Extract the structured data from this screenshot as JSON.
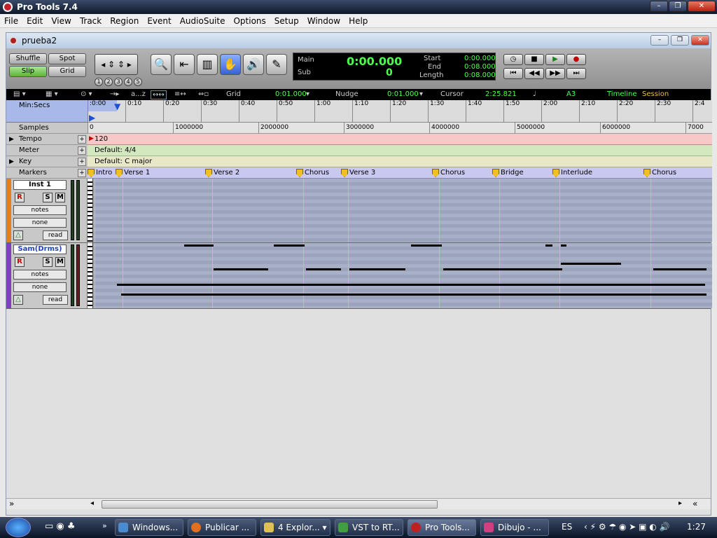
{
  "app": {
    "title": "Pro Tools 7.4",
    "doc_title": "prueba2"
  },
  "menu": [
    "File",
    "Edit",
    "View",
    "Track",
    "Region",
    "Event",
    "AudioSuite",
    "Options",
    "Setup",
    "Window",
    "Help"
  ],
  "modes": {
    "shuffle": "Shuffle",
    "spot": "Spot",
    "slip": "Slip",
    "grid": "Grid"
  },
  "zoom_presets": [
    "1",
    "2",
    "3",
    "4",
    "5"
  ],
  "counter": {
    "main_label": "Main",
    "main_value": "0:00.000",
    "sub_label": "Sub",
    "sub_value": "0",
    "start_label": "Start",
    "start_value": "0:00.000",
    "end_label": "End",
    "end_value": "0:08.000",
    "length_label": "Length",
    "length_value": "0:08.000"
  },
  "gridbar": {
    "sort_label": "a...z",
    "grid_label": "Grid",
    "grid_value": "0:01.000",
    "nudge_label": "Nudge",
    "nudge_value": "0:01.000",
    "cursor_label": "Cursor",
    "cursor_value": "2:25.821",
    "pitch": "A3",
    "timeline": "Timeline",
    "session": "Session"
  },
  "rulers": {
    "minsecs": "Min:Secs",
    "samples": "Samples",
    "tempo": "Tempo",
    "meter": "Meter",
    "key": "Key",
    "markers": "Markers",
    "tempo_value": "120",
    "meter_value": "Default: 4/4",
    "key_value": "Default: C major"
  },
  "time_ticks": [
    ":0:00",
    "0:10",
    "0:20",
    "0:30",
    "0:40",
    "0:50",
    "1:00",
    "1:10",
    "1:20",
    "1:30",
    "1:40",
    "1:50",
    "2:00",
    "2:10",
    "2:20",
    "2:30",
    "2:4"
  ],
  "sample_ticks": [
    "0",
    "1000000",
    "2000000",
    "3000000",
    "4000000",
    "5000000",
    "6000000",
    "7000"
  ],
  "markers": [
    "Intro",
    "Verse 1",
    "Verse 2",
    "Chorus",
    "Verse 3",
    "Chorus",
    "Bridge",
    "Interlude",
    "Chorus"
  ],
  "tracks": [
    {
      "name": "Inst 1",
      "r": "R",
      "s": "S",
      "m": "M",
      "view": "notes",
      "input": "none",
      "auto": "read",
      "color": "#e08020"
    },
    {
      "name": "Sam(Drms)",
      "r": "R",
      "s": "S",
      "m": "M",
      "view": "notes",
      "input": "none",
      "auto": "read",
      "color": "#8040c0"
    }
  ],
  "taskbar": {
    "items": [
      "Windows...",
      "Publicar ...",
      "4 Explor...",
      "VST to RT...",
      "Pro Tools...",
      "Dibujo - ..."
    ],
    "lang": "ES",
    "clock": "1:27"
  }
}
